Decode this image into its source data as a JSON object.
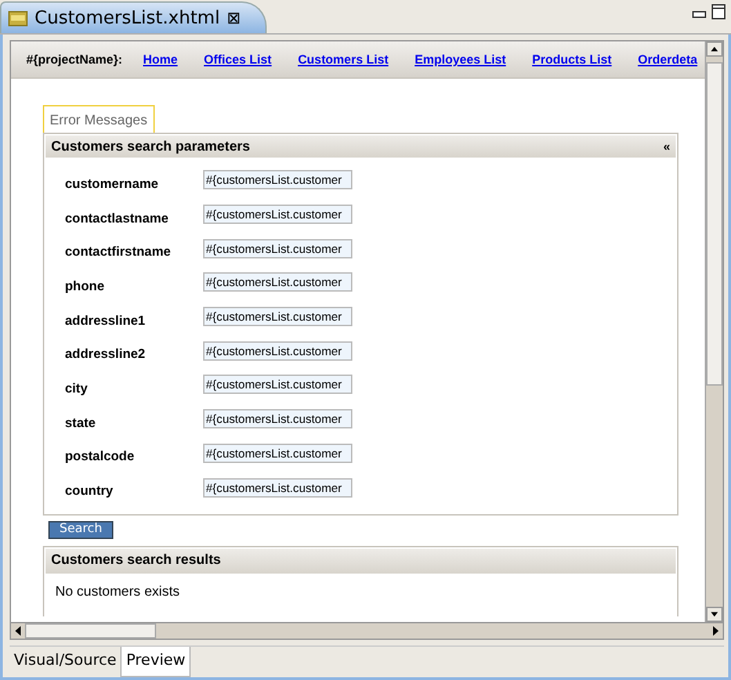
{
  "editor_tab": {
    "title": "CustomersList.xhtml",
    "close": "⊠"
  },
  "nav": {
    "project": "#{projectName}:",
    "links": [
      "Home",
      "Offices List",
      "Customers List",
      "Employees List",
      "Products List",
      "Orderdeta"
    ]
  },
  "messages_tab": {
    "label": "Error Messages"
  },
  "search_panel": {
    "title": "Customers search parameters",
    "collapse": "«",
    "fields": [
      {
        "label": "customername",
        "value": "#{customersList.customer"
      },
      {
        "label": "contactlastname",
        "value": "#{customersList.customer"
      },
      {
        "label": "contactfirstname",
        "value": "#{customersList.customer"
      },
      {
        "label": "phone",
        "value": "#{customersList.customer"
      },
      {
        "label": "addressline1",
        "value": "#{customersList.customer"
      },
      {
        "label": "addressline2",
        "value": "#{customersList.customer"
      },
      {
        "label": "city",
        "value": "#{customersList.customer"
      },
      {
        "label": "state",
        "value": "#{customersList.customer"
      },
      {
        "label": "postalcode",
        "value": "#{customersList.customer"
      },
      {
        "label": "country",
        "value": "#{customersList.customer"
      }
    ]
  },
  "search_button": "Search",
  "results_panel": {
    "title": "Customers search results",
    "message": "No customers exists"
  },
  "bottom_tabs": [
    {
      "label": "Visual/Source",
      "selected": false
    },
    {
      "label": "Preview",
      "selected": true
    }
  ]
}
